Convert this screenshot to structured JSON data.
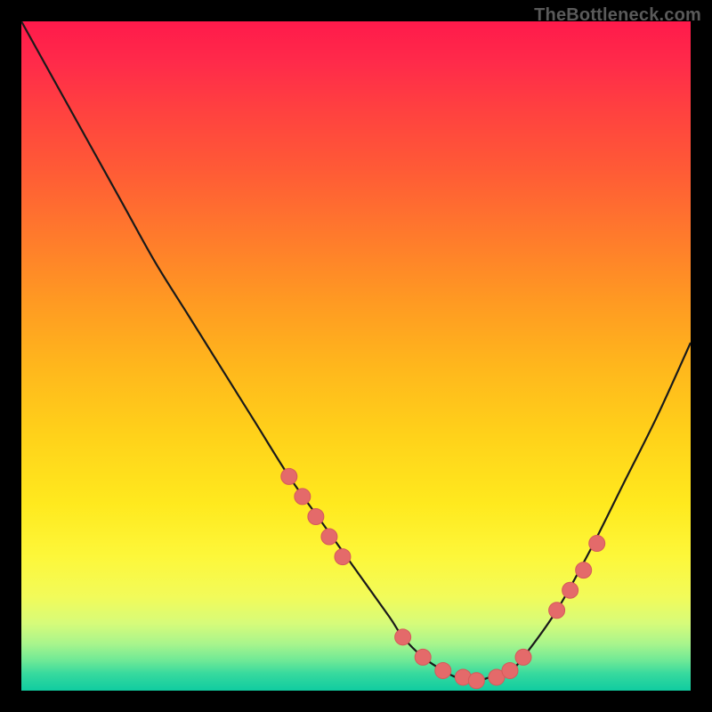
{
  "watermark": "TheBottleneck.com",
  "colors": {
    "background": "#000000",
    "curve_stroke": "#1a1a1a",
    "marker_fill": "#e46a6a",
    "marker_stroke": "#d55a5a"
  },
  "chart_data": {
    "type": "line",
    "title": "",
    "xlabel": "",
    "ylabel": "",
    "xlim": [
      0,
      100
    ],
    "ylim": [
      0,
      100
    ],
    "grid": false,
    "curve": {
      "name": "bottleneck-curve",
      "x": [
        0,
        5,
        10,
        15,
        20,
        25,
        30,
        35,
        40,
        45,
        50,
        55,
        57,
        60,
        63,
        65,
        68,
        70,
        73,
        75,
        80,
        85,
        90,
        95,
        100
      ],
      "y": [
        100,
        91,
        82,
        73,
        64,
        56,
        48,
        40,
        32,
        25,
        18,
        11,
        8,
        5,
        3,
        2,
        1.5,
        2,
        3,
        5,
        12,
        21,
        31,
        41,
        52
      ]
    },
    "markers": {
      "name": "highlight-points",
      "x": [
        40,
        42,
        44,
        46,
        48,
        57,
        60,
        63,
        66,
        68,
        71,
        73,
        75,
        80,
        82,
        84,
        86
      ],
      "y": [
        32,
        29,
        26,
        23,
        20,
        8,
        5,
        3,
        2,
        1.5,
        2,
        3,
        5,
        12,
        15,
        18,
        22
      ]
    }
  }
}
